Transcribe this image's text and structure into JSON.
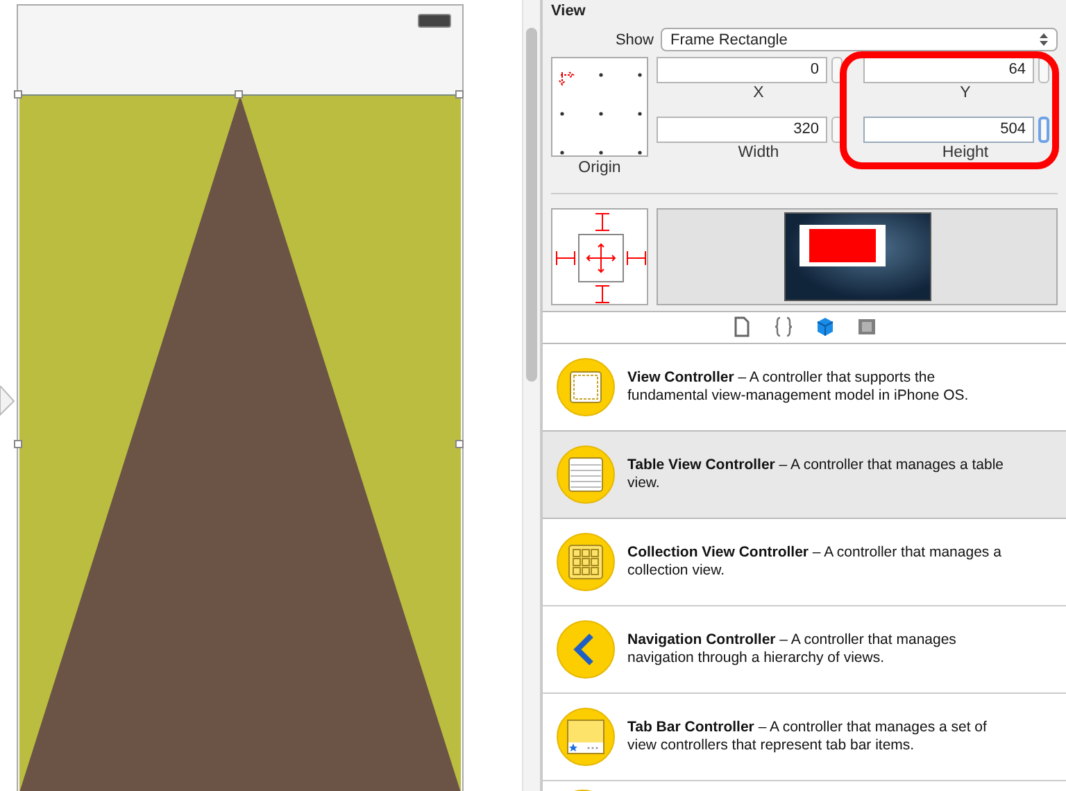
{
  "inspector": {
    "title": "View",
    "show_label": "Show",
    "show_value": "Frame Rectangle",
    "origin_label": "Origin",
    "fields": [
      {
        "label": "X",
        "value": "0",
        "focused": false
      },
      {
        "label": "Y",
        "value": "64",
        "focused": false
      },
      {
        "label": "Width",
        "value": "320",
        "focused": false
      },
      {
        "label": "Height",
        "value": "504",
        "focused": true
      }
    ]
  },
  "library_tabs": [
    {
      "kind": "file",
      "selected": false
    },
    {
      "kind": "braces",
      "selected": false
    },
    {
      "kind": "cube",
      "selected": true
    },
    {
      "kind": "film",
      "selected": false
    }
  ],
  "library_items": [
    {
      "kind": "view",
      "text": "**View Controller** – A controller that supports the fundamental view-management model in iPhone OS.",
      "selected": false
    },
    {
      "kind": "table",
      "text": "**Table View Controller** – A controller that manages a table view.",
      "selected": true
    },
    {
      "kind": "collection",
      "text": "**Collection View Controller** – A controller that manages a collection view.",
      "selected": false
    },
    {
      "kind": "navigation",
      "text": "**Navigation Controller** – A controller that manages navigation through a hierarchy of views.",
      "selected": false
    },
    {
      "kind": "tabbar",
      "text": "**Tab Bar Controller** – A controller that manages a set of view controllers that represent tab bar items.",
      "selected": false
    }
  ]
}
